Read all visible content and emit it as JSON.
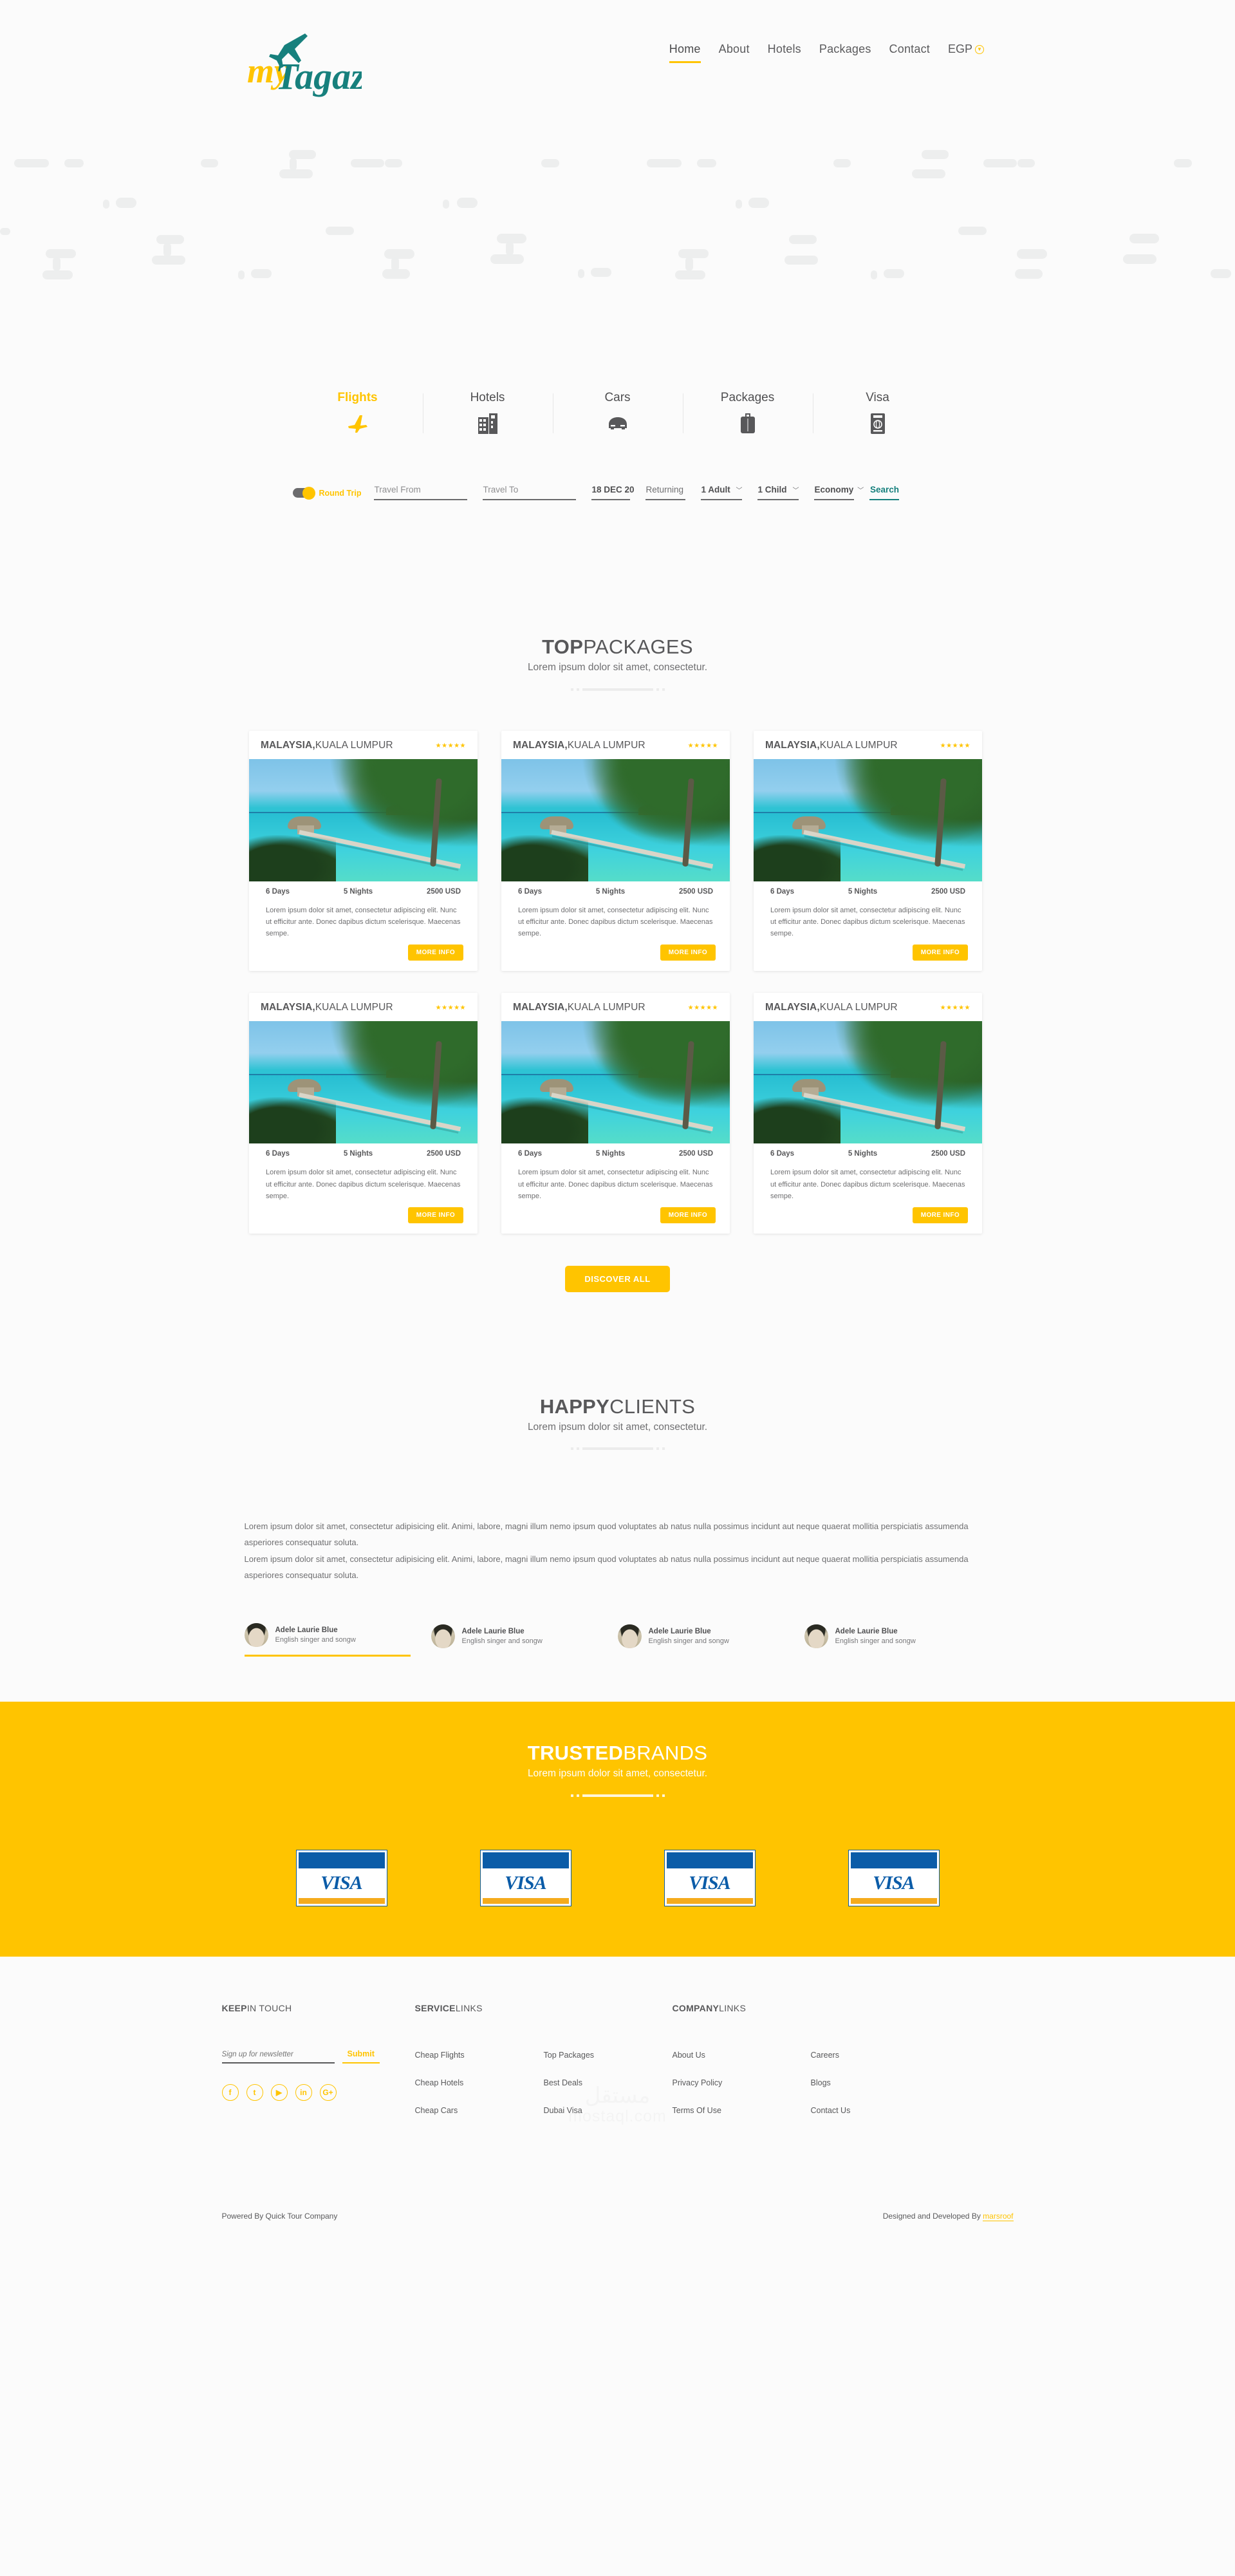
{
  "brand": {
    "name": "myTagaza",
    "logo_text_1": "my",
    "logo_text_2": "Tagaza"
  },
  "header": {
    "nav": [
      {
        "label": "Home",
        "active": true
      },
      {
        "label": "About",
        "active": false
      },
      {
        "label": "Hotels",
        "active": false
      },
      {
        "label": "Packages",
        "active": false
      },
      {
        "label": "Contact",
        "active": false
      }
    ],
    "currency": "EGP"
  },
  "booking": {
    "tabs": [
      {
        "label": "Flights",
        "icon": "plane-icon",
        "active": true
      },
      {
        "label": "Hotels",
        "icon": "hotel-icon",
        "active": false
      },
      {
        "label": "Cars",
        "icon": "car-icon",
        "active": false
      },
      {
        "label": "Packages",
        "icon": "suitcase-icon",
        "active": false
      },
      {
        "label": "Visa",
        "icon": "passport-icon",
        "active": false
      }
    ],
    "trip_toggle_label": "Round Trip",
    "travel_from_placeholder": "Travel From",
    "travel_to_placeholder": "Travel To",
    "depart_date": "18 DEC 20",
    "returning_placeholder": "Returning",
    "adults": "1 Adult",
    "children": "1 Child",
    "cabin": "Economy",
    "search_label": "Search"
  },
  "packages_section": {
    "title_bold": "TOP",
    "title_light": "PACKAGES",
    "subtitle": "Lorem ipsum dolor sit amet, consectetur.",
    "discover_label": "DISCOVER ALL",
    "cards": [
      {
        "country": "MALAYSIA,",
        "city": "KUALA LUMPUR",
        "stars": "★★★★★",
        "days": "6 Days",
        "nights": "5 Nights",
        "price": "2500 USD",
        "desc": "Lorem ipsum dolor sit amet, consectetur adipiscing elit. Nunc ut efficitur ante. Donec dapibus dictum scelerisque. Maecenas sempe.",
        "button": "MORE INFO"
      },
      {
        "country": "MALAYSIA,",
        "city": "KUALA LUMPUR",
        "stars": "★★★★★",
        "days": "6 Days",
        "nights": "5 Nights",
        "price": "2500 USD",
        "desc": "Lorem ipsum dolor sit amet, consectetur adipiscing elit. Nunc ut efficitur ante. Donec dapibus dictum scelerisque. Maecenas sempe.",
        "button": "MORE INFO"
      },
      {
        "country": "MALAYSIA,",
        "city": "KUALA LUMPUR",
        "stars": "★★★★★",
        "days": "6 Days",
        "nights": "5 Nights",
        "price": "2500 USD",
        "desc": "Lorem ipsum dolor sit amet, consectetur adipiscing elit. Nunc ut efficitur ante. Donec dapibus dictum scelerisque. Maecenas sempe.",
        "button": "MORE INFO"
      },
      {
        "country": "MALAYSIA,",
        "city": "KUALA LUMPUR",
        "stars": "★★★★★",
        "days": "6 Days",
        "nights": "5 Nights",
        "price": "2500 USD",
        "desc": "Lorem ipsum dolor sit amet, consectetur adipiscing elit. Nunc ut efficitur ante. Donec dapibus dictum scelerisque. Maecenas sempe.",
        "button": "MORE INFO"
      },
      {
        "country": "MALAYSIA,",
        "city": "KUALA LUMPUR",
        "stars": "★★★★★",
        "days": "6 Days",
        "nights": "5 Nights",
        "price": "2500 USD",
        "desc": "Lorem ipsum dolor sit amet, consectetur adipiscing elit. Nunc ut efficitur ante. Donec dapibus dictum scelerisque. Maecenas sempe.",
        "button": "MORE INFO"
      },
      {
        "country": "MALAYSIA,",
        "city": "KUALA LUMPUR",
        "stars": "★★★★★",
        "days": "6 Days",
        "nights": "5 Nights",
        "price": "2500 USD",
        "desc": "Lorem ipsum dolor sit amet, consectetur adipiscing elit. Nunc ut efficitur ante. Donec dapibus dictum scelerisque. Maecenas sempe.",
        "button": "MORE INFO"
      }
    ]
  },
  "clients_section": {
    "title_bold": "HAPPY",
    "title_light": "CLIENTS",
    "subtitle": "Lorem ipsum dolor sit amet, consectetur.",
    "paragraph_1": "Lorem ipsum dolor sit amet, consectetur adipisicing elit. Animi, labore, magni illum nemo ipsum quod voluptates ab natus nulla possimus incidunt aut neque quaerat mollitia perspiciatis assumenda asperiores consequatur soluta.",
    "paragraph_2": "Lorem ipsum dolor sit amet, consectetur adipisicing elit. Animi, labore, magni illum nemo ipsum quod voluptates ab natus nulla possimus incidunt aut neque quaerat mollitia perspiciatis assumenda asperiores consequatur soluta.",
    "clients": [
      {
        "name": "Adele Laurie Blue",
        "role": "English singer and songw",
        "active": true
      },
      {
        "name": "Adele Laurie Blue",
        "role": "English singer and songw",
        "active": false
      },
      {
        "name": "Adele Laurie Blue",
        "role": "English singer and songw",
        "active": false
      },
      {
        "name": "Adele Laurie Blue",
        "role": "English singer and songw",
        "active": false
      }
    ]
  },
  "brands_section": {
    "title_bold": "TRUSTED",
    "title_light": "BRANDS",
    "subtitle": "Lorem ipsum dolor sit amet, consectetur.",
    "logos": [
      {
        "name": "VISA"
      },
      {
        "name": "VISA"
      },
      {
        "name": "VISA"
      },
      {
        "name": "VISA"
      }
    ]
  },
  "footer": {
    "keep_in_touch_bold": "KEEP",
    "keep_in_touch_light": "IN TOUCH",
    "newsletter_placeholder": "Sign up for newsletter",
    "newsletter_submit": "Submit",
    "socials": [
      {
        "name": "facebook-icon",
        "glyph": "f"
      },
      {
        "name": "twitter-icon",
        "glyph": "t"
      },
      {
        "name": "youtube-icon",
        "glyph": "▶"
      },
      {
        "name": "linkedin-icon",
        "glyph": "in"
      },
      {
        "name": "google-plus-icon",
        "glyph": "G+"
      }
    ],
    "service_title_bold": "SERVICE",
    "service_title_light": "LINKS",
    "service_links": [
      "Cheap Flights",
      "Top Packages",
      "Cheap Hotels",
      "Best Deals",
      "Cheap Cars",
      "Dubai Visa"
    ],
    "company_title_bold": "COMPANY",
    "company_title_light": "LINKS",
    "company_links": [
      "About Us",
      "Careers",
      "Privacy Policy",
      "Blogs",
      "Terms Of Use",
      "Contact Us"
    ],
    "watermark_ar": "مستقل",
    "watermark_en": "mostaql.com",
    "powered_by": "Powered By Quick Tour Company",
    "designed_by_prefix": "Designed and Developed By ",
    "designed_by_link": "marsroof"
  },
  "colors": {
    "accent": "#ffc400",
    "teal": "#17807d",
    "text": "#58585a",
    "bg": "#fbfbfb",
    "visa_blue": "#0b5ca8"
  }
}
